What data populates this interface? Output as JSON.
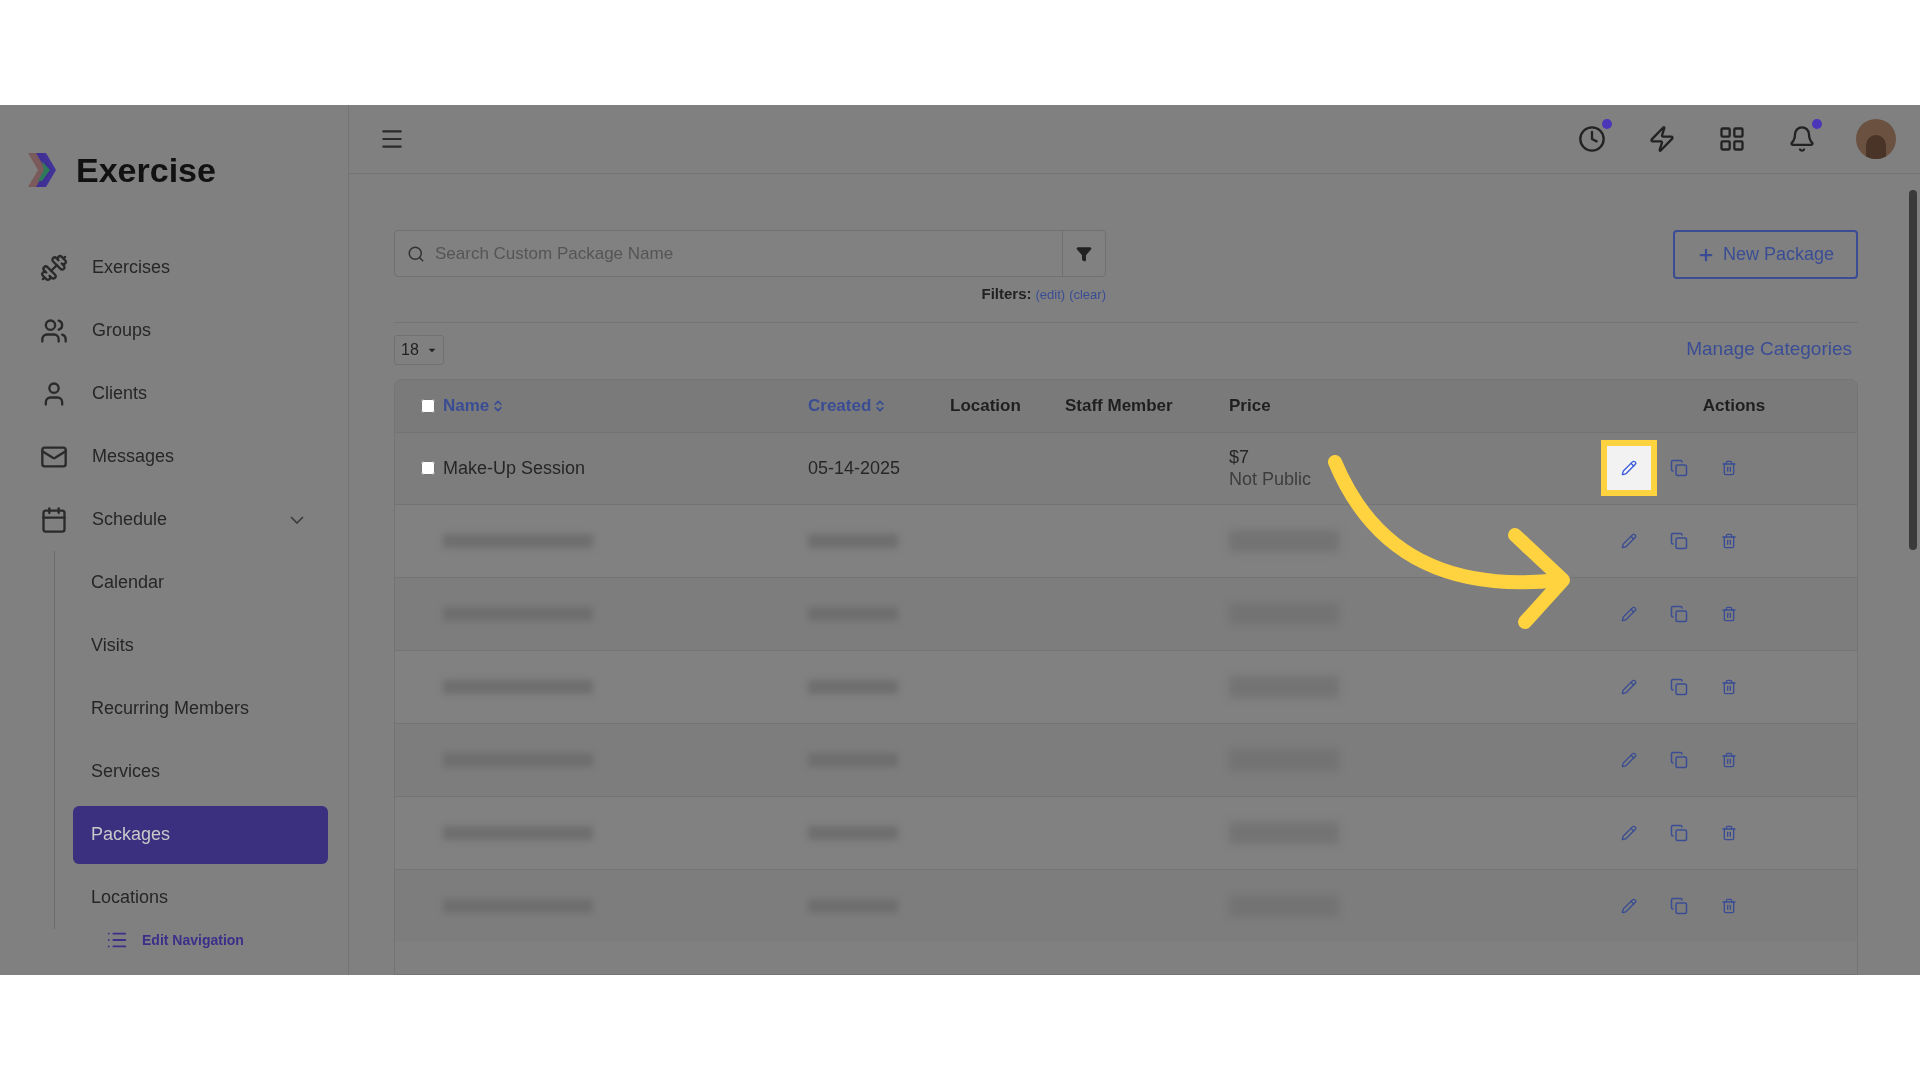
{
  "sidebar": {
    "brand": "Exercise",
    "items": [
      {
        "label": "Exercises",
        "selected": false
      },
      {
        "label": "Groups",
        "selected": false
      },
      {
        "label": "Clients",
        "selected": false
      },
      {
        "label": "Messages",
        "selected": false
      },
      {
        "label": "Schedule",
        "selected": false,
        "expanded": true,
        "children": [
          {
            "label": "Calendar",
            "selected": false
          },
          {
            "label": "Visits",
            "selected": false
          },
          {
            "label": "Recurring Members",
            "selected": false
          },
          {
            "label": "Services",
            "selected": false
          },
          {
            "label": "Packages",
            "selected": true
          },
          {
            "label": "Locations",
            "selected": false
          }
        ]
      }
    ],
    "edit_navigation": "Edit Navigation"
  },
  "header": {
    "icons": [
      {
        "kind": "clock",
        "badge": true
      },
      {
        "kind": "bolt",
        "badge": false
      },
      {
        "kind": "apps",
        "badge": false
      },
      {
        "kind": "bell",
        "badge": true
      }
    ]
  },
  "search": {
    "placeholder": "Search Custom Package Name"
  },
  "filters": {
    "label": "Filters:",
    "edit": "(edit)",
    "clear": "(clear)"
  },
  "new_button": "New Package",
  "per_page": "18",
  "manage_categories": "Manage Categories",
  "table": {
    "select_all_checked": false,
    "columns": [
      {
        "label": "Name",
        "sortable": true
      },
      {
        "label": "Created",
        "sortable": true
      },
      {
        "label": "Location",
        "sortable": false
      },
      {
        "label": "Staff Member",
        "sortable": false
      },
      {
        "label": "Price",
        "sortable": false
      },
      {
        "label": "Actions",
        "sortable": false
      }
    ],
    "rows": [
      {
        "kind": "visible",
        "checked": false,
        "name": "Make-Up Session",
        "created": "05-14-2025",
        "price": "$7",
        "price_note": "Not Public",
        "edit_highlighted": true
      },
      {
        "kind": "blurred"
      },
      {
        "kind": "blurred"
      },
      {
        "kind": "blurred"
      },
      {
        "kind": "blurred"
      },
      {
        "kind": "blurred"
      },
      {
        "kind": "blurred"
      }
    ]
  }
}
